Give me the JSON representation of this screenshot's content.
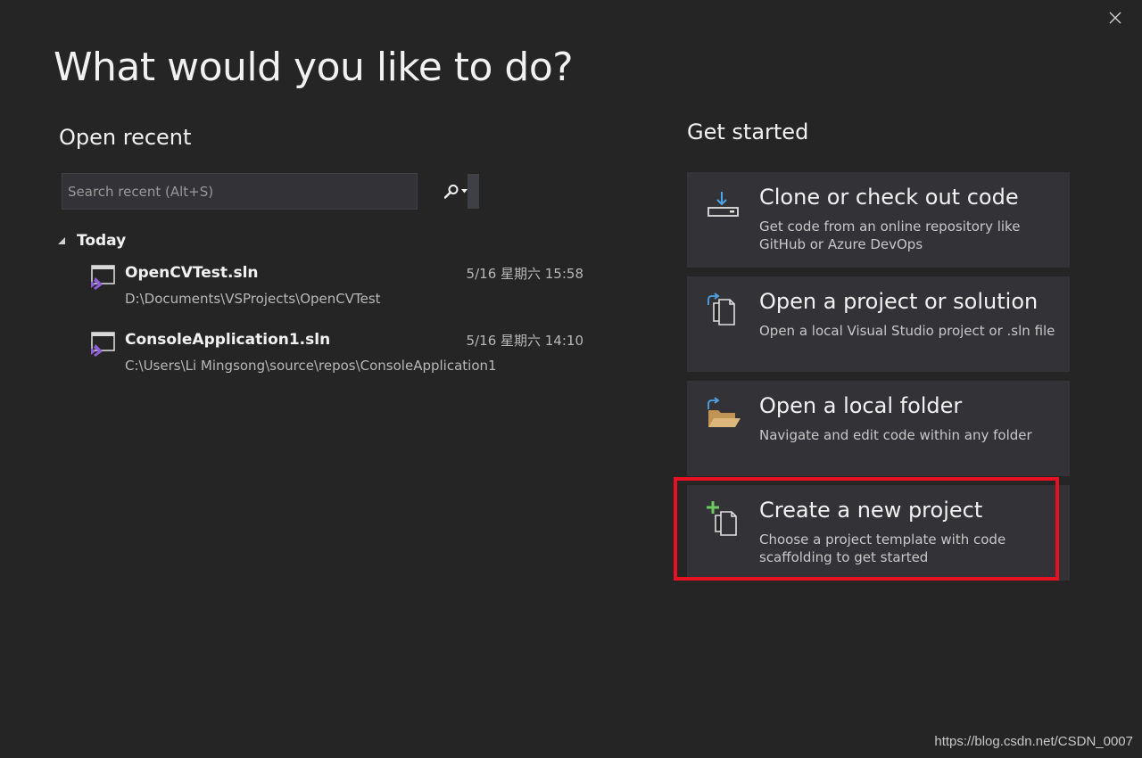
{
  "window": {
    "close_icon": "close-icon"
  },
  "heading": "What would you like to do?",
  "open_recent": {
    "title": "Open recent",
    "search": {
      "placeholder": "Search recent (Alt+S)",
      "value": ""
    },
    "groups": [
      {
        "label": "Today",
        "items": [
          {
            "name": "OpenCVTest.sln",
            "path": "D:\\Documents\\VSProjects\\OpenCVTest",
            "date": "5/16 星期六 15:58"
          },
          {
            "name": "ConsoleApplication1.sln",
            "path": "C:\\Users\\Li Mingsong\\source\\repos\\ConsoleApplication1",
            "date": "5/16 星期六 14:10"
          }
        ]
      }
    ]
  },
  "get_started": {
    "title": "Get started",
    "cards": [
      {
        "title": "Clone or check out code",
        "desc": "Get code from an online repository like GitHub or Azure DevOps",
        "icon": "download-icon"
      },
      {
        "title": "Open a project or solution",
        "desc": "Open a local Visual Studio project or .sln file",
        "icon": "open-project-icon"
      },
      {
        "title": "Open a local folder",
        "desc": "Navigate and edit code within any folder",
        "icon": "folder-open-icon"
      },
      {
        "title": "Create a new project",
        "desc": "Choose a project template with code scaffolding to get started",
        "icon": "new-project-icon"
      }
    ]
  },
  "colors": {
    "background": "#252526",
    "card": "#333337",
    "highlight": "#e81123",
    "vs_purple": "#8f5fd8"
  },
  "watermark": "https://blog.csdn.net/CSDN_0007"
}
